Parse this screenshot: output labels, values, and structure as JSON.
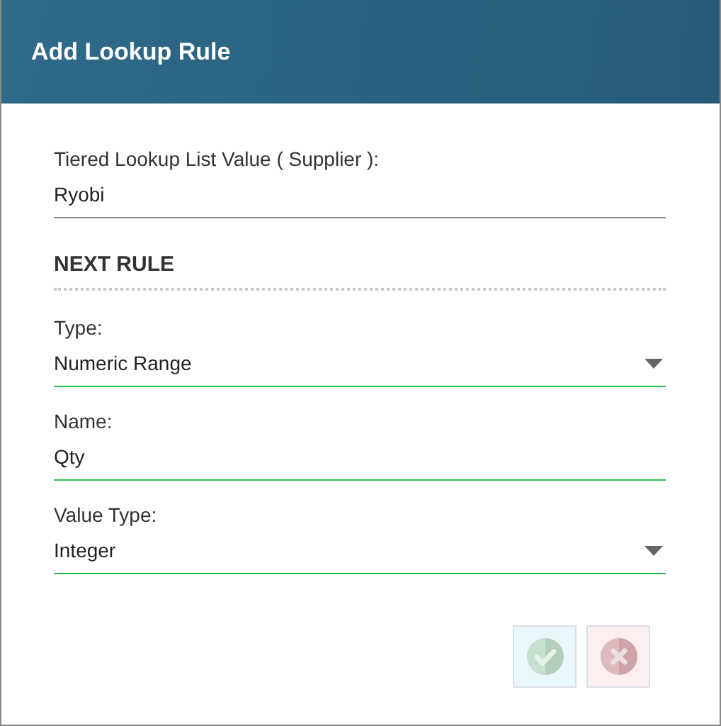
{
  "dialog": {
    "title": "Add Lookup Rule"
  },
  "fields": [
    {
      "kind": "readonly",
      "label": "Tiered Lookup List Value ( Supplier ):",
      "value": "Ryobi"
    }
  ],
  "section": {
    "title": "NEXT RULE"
  },
  "rule_fields": [
    {
      "kind": "select",
      "label": "Type:",
      "value": "Numeric Range"
    },
    {
      "kind": "text",
      "label": "Name:",
      "value": "Qty"
    },
    {
      "kind": "select",
      "label": "Value Type:",
      "value": "Integer"
    }
  ],
  "buttons": [
    {
      "kind": "confirm",
      "disabled": true
    },
    {
      "kind": "cancel",
      "disabled": true
    }
  ]
}
